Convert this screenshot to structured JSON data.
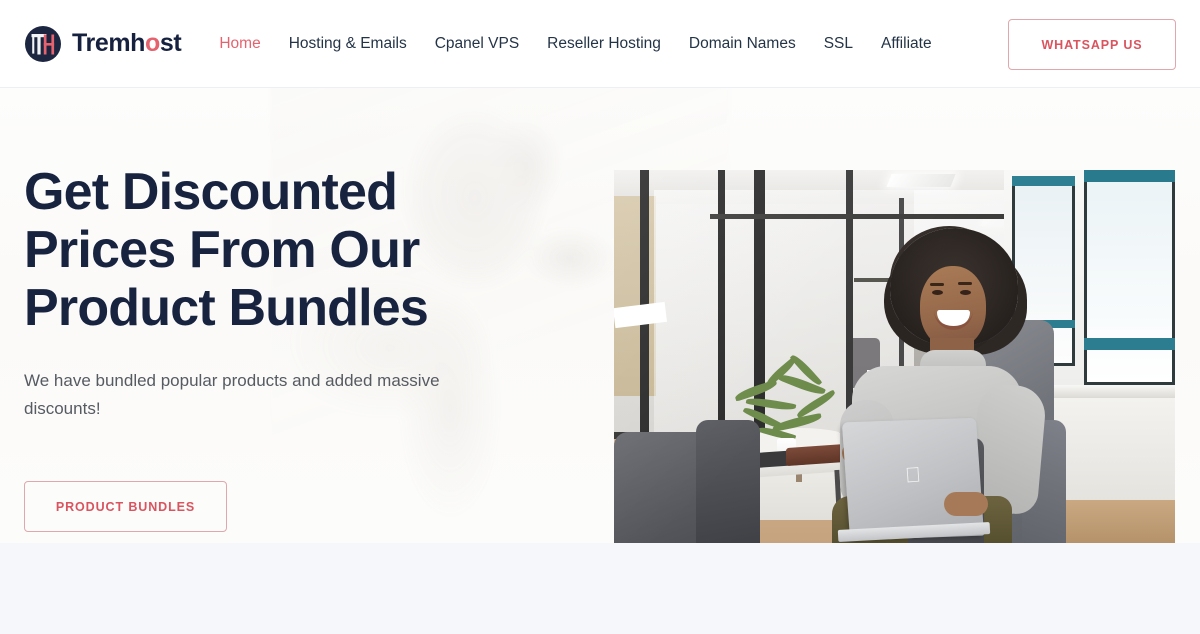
{
  "header": {
    "brand": {
      "name_part1": "Tremh",
      "name_accent": "o",
      "name_part2": "st",
      "logo_icon": "tremhost-th-monogram-icon"
    },
    "nav_items": [
      {
        "label": "Home",
        "active": true
      },
      {
        "label": "Hosting & Emails",
        "active": false
      },
      {
        "label": "Cpanel VPS",
        "active": false
      },
      {
        "label": "Reseller Hosting",
        "active": false
      },
      {
        "label": "Domain Names",
        "active": false
      },
      {
        "label": "SSL",
        "active": false
      },
      {
        "label": "Affiliate",
        "active": false
      }
    ],
    "cta_label": "WHATSAPP US"
  },
  "hero": {
    "title": "Get Discounted Prices From Our Product Bundles",
    "subtitle": "We have bundled popular products and added massive discounts!",
    "cta_label": "PRODUCT BUNDLES",
    "image_alt": "Smiling woman with afro hair in grey turtleneck working on a silver MacBook while seated in a grey armchair in a modern office"
  },
  "colors": {
    "accent_red": "#e4636f",
    "cta_red": "#d9545f",
    "cta_border": "#e0a8ad",
    "heading_navy": "#17233f",
    "nav_text": "#243447",
    "body_text": "#565b62",
    "header_bg": "#ffffff",
    "hero_bg": "#fcfcfb",
    "page_bg": "#f5f7fa"
  }
}
